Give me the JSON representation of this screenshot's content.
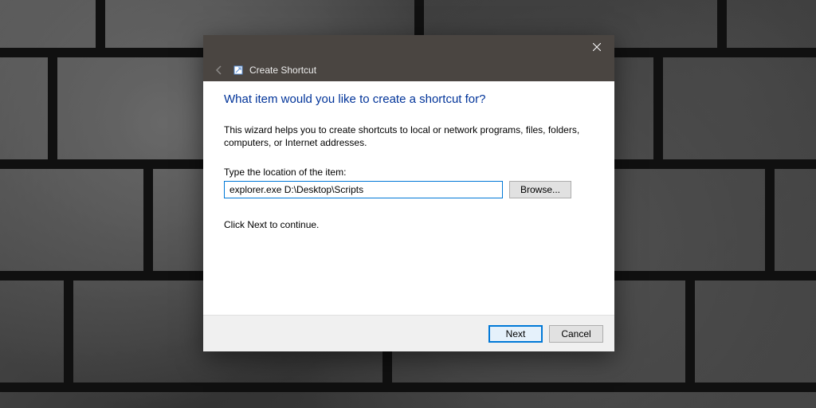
{
  "titlebar": {
    "wizard_name": "Create Shortcut"
  },
  "content": {
    "heading": "What item would you like to create a shortcut for?",
    "description": "This wizard helps you to create shortcuts to local or network programs, files, folders, computers, or Internet addresses.",
    "field_label": "Type the location of the item:",
    "input_value": "explorer.exe D:\\Desktop\\Scripts",
    "browse_label": "Browse...",
    "continue_text": "Click Next to continue."
  },
  "footer": {
    "next_label": "Next",
    "cancel_label": "Cancel"
  }
}
